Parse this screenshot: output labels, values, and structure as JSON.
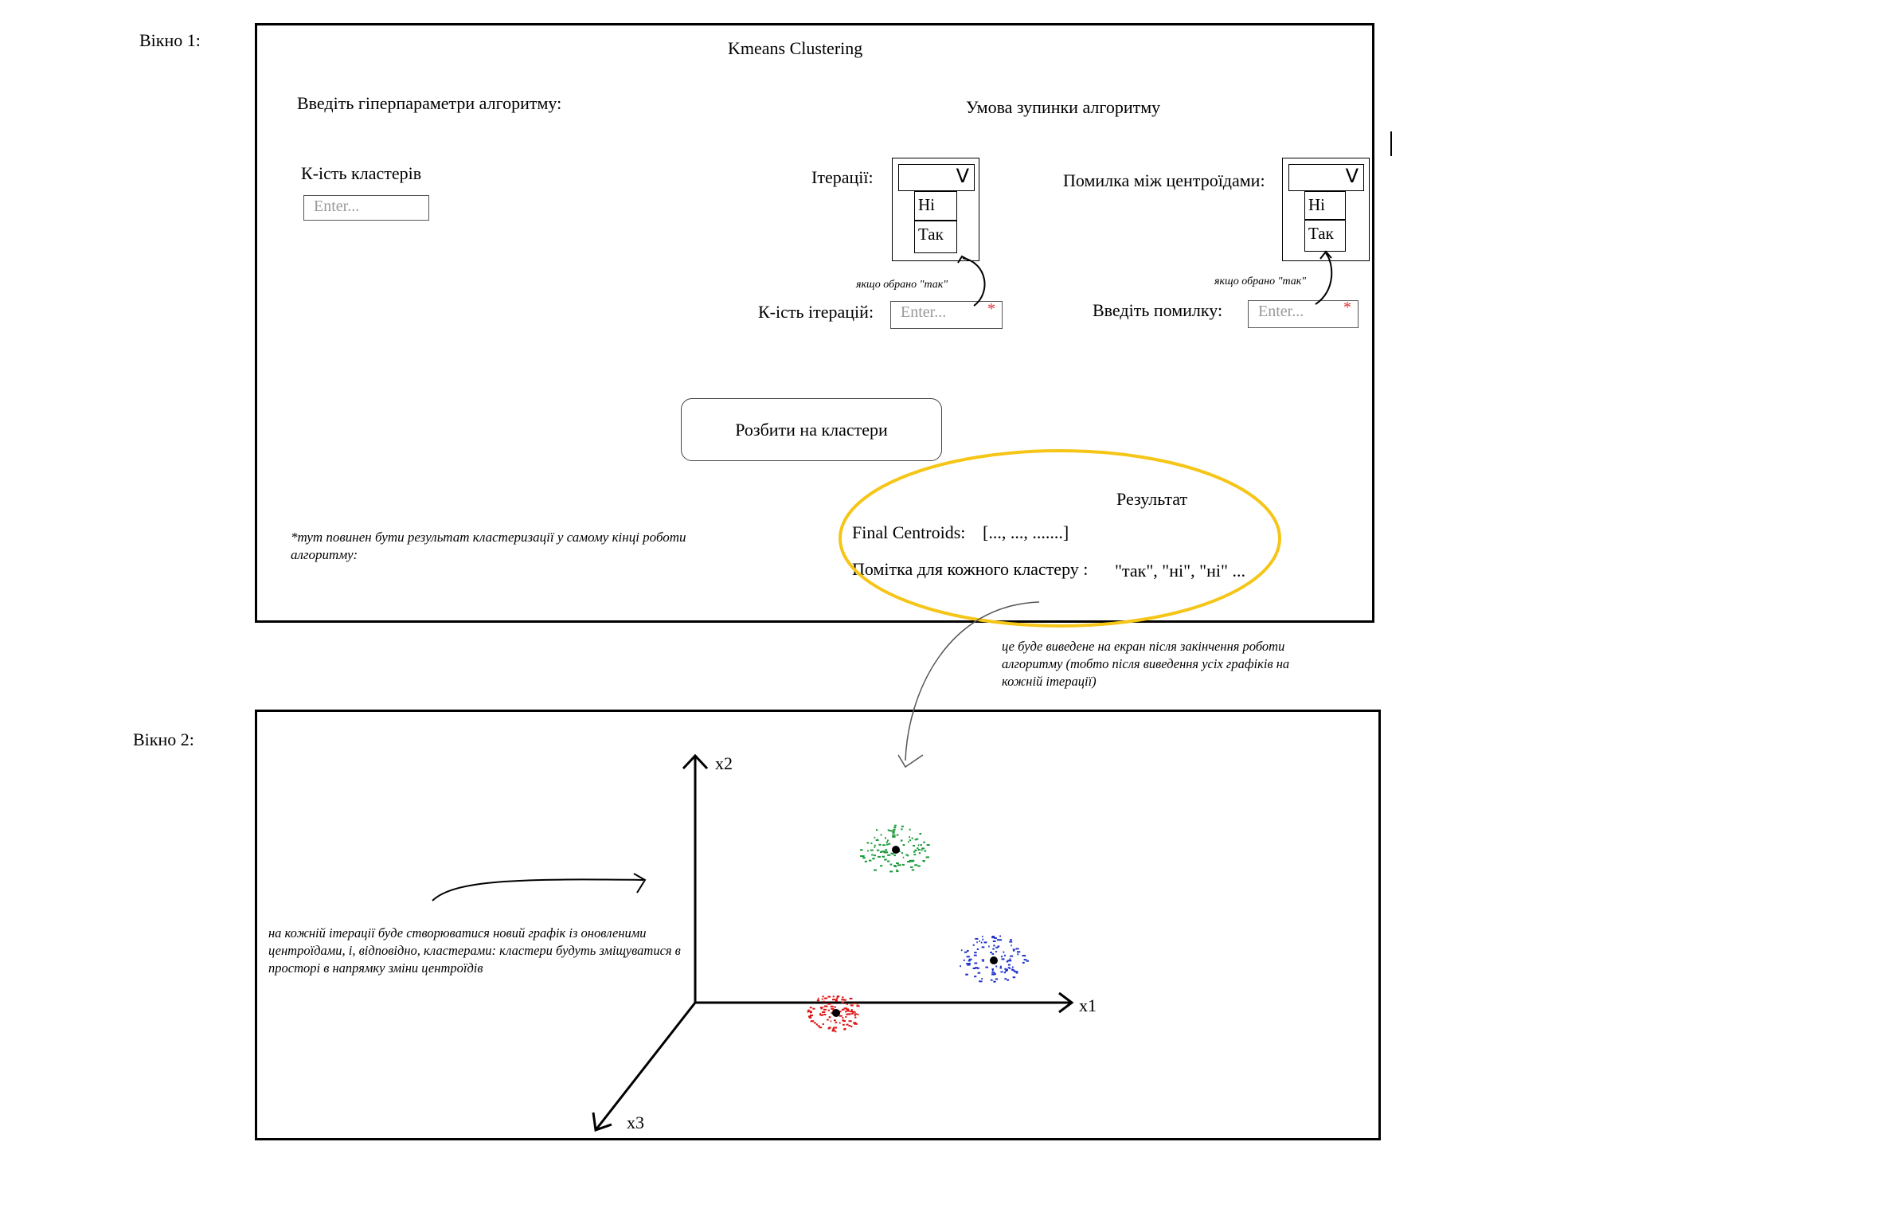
{
  "window1": {
    "label": "Вікно 1:",
    "title": "Kmeans Clustering",
    "hyperparams_heading": "Введіть гіперпараметри алгоритму:",
    "stop_heading": "Умова зупинки алгоритму",
    "clusters_label": "К-ість кластерів",
    "clusters_input_placeholder": "Enter...",
    "iterations": {
      "label": "Ітерації:",
      "chevron": "V",
      "options": [
        "Ні",
        "Так"
      ],
      "note": "якщо обрано \"так\"",
      "count_label": "К-ість ітерацій:",
      "count_placeholder": "Enter...",
      "required_mark": "*"
    },
    "centroid_error": {
      "label": "Помилка між центроїдами:",
      "chevron": "V",
      "options": [
        "Ні",
        "Так"
      ],
      "note": "якщо обрано \"так\"",
      "input_label": "Введіть помилку:",
      "input_placeholder": "Enter...",
      "required_mark": "*"
    },
    "run_button": "Розбити на кластери",
    "result_note": "*тут повинен бути результат кластеризації у самому кінці роботи алгоритму:",
    "result": {
      "heading": "Результат",
      "centroids_label": "Final Centroids:",
      "centroids_value": "[..., ..., .......]",
      "marks_label": "Помітка для кожного кластеру :",
      "marks_value": "\"так\", \"ні\", \"ні\" ...",
      "highlight_color": "#f5c518"
    },
    "after_note": "це буде виведене на екран після закінчення роботи алгоритму (тобто після виведення усіх графіків на кожній ітерації)"
  },
  "window2": {
    "label": "Вікно 2:",
    "axes": {
      "x1": "x1",
      "x2": "x2",
      "x3": "x3"
    },
    "iteration_note": "на кожній ітерації буде створюватися новий графік із оновленими центроїдами, і, відповідно, кластерами: кластери будуть зміщуватися в просторі в напрямку зміни центроїдів",
    "clusters": [
      {
        "color": "#1a9a3a",
        "name": "green-cluster"
      },
      {
        "color": "#2233cc",
        "name": "blue-cluster"
      },
      {
        "color": "#dd1111",
        "name": "red-cluster"
      }
    ]
  }
}
